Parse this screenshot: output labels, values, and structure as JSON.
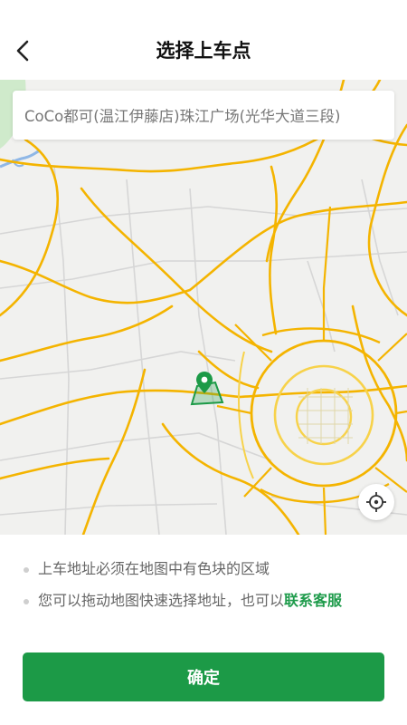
{
  "header": {
    "title": "选择上车点",
    "back_icon": "chevron-left-icon"
  },
  "search": {
    "value": "CoCo都可(温江伊藤店)珠江广场(光华大道三段)"
  },
  "map": {
    "locate_icon": "crosshair-icon",
    "pin_icon": "location-pin-icon",
    "colors": {
      "highway": "#f4b400",
      "ring_road": "#f7d24a",
      "minor_road": "#d2d2d2",
      "water": "#8fb7e6",
      "park": "#cfeacb",
      "zone": "#1c9a47"
    }
  },
  "tips": {
    "tip1": "上车地址必须在地图中有色块的区域",
    "tip2_prefix": "您可以拖动地图快速选择地址，也可以",
    "tip2_link": "联系客服"
  },
  "confirm": {
    "label": "确定",
    "color": "#1c9a47"
  }
}
